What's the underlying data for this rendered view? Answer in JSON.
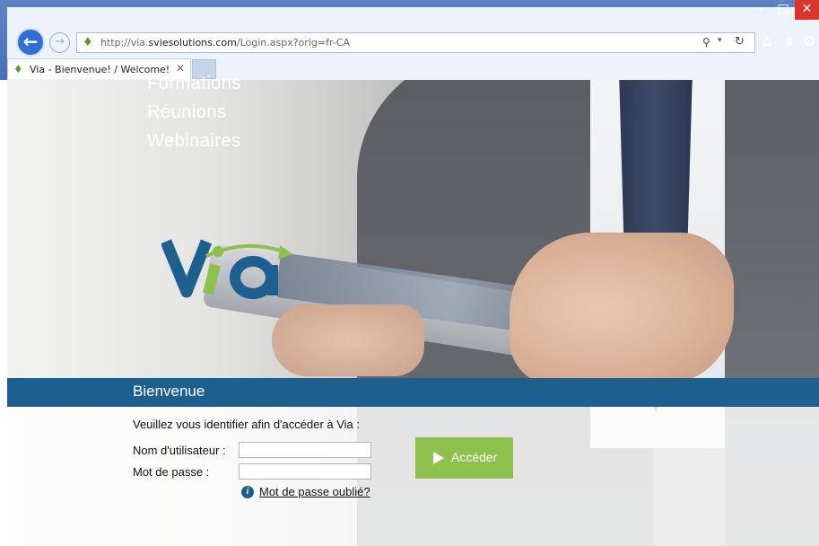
{
  "browser": {
    "url_prefix": "http://via.",
    "url_domain": "sviesolutions.com",
    "url_path": "/Login.aspx?orig=fr-CA",
    "tab_title": "Via - Bienvenue! / Welcome!",
    "tab_close_glyph": "✕",
    "window_min_glyph": "–",
    "window_max_glyph": "□",
    "window_close_glyph": "✕",
    "back_glyph": "←",
    "forward_glyph": "→",
    "search_glyph": "⚲",
    "dropdown_glyph": "▾",
    "refresh_glyph": "↻",
    "home_glyph": "⌂",
    "star_glyph": "★",
    "gear_glyph": "⚙",
    "icons": [
      "back-icon",
      "forward-icon",
      "search-icon",
      "refresh-icon",
      "home-icon",
      "star-icon",
      "gear-icon"
    ]
  },
  "hero": {
    "taglines": [
      "Formations",
      "Réunions",
      "Webinaires"
    ],
    "logo_text": "Via"
  },
  "login": {
    "heading": "Bienvenue",
    "instruction": "Veuillez vous identifier afin d'accéder à Via :",
    "username_label": "Nom d'utilisateur :",
    "username_value": "",
    "password_label": "Mot de passe :",
    "password_value": "",
    "forgot_link": "Mot de passe oublié?",
    "submit_label": "Accéder"
  },
  "colors": {
    "band": "#1d5f8f",
    "submit": "#8dc04d",
    "logo_blue": "#1d5f8f",
    "logo_green": "#8dc04d"
  }
}
